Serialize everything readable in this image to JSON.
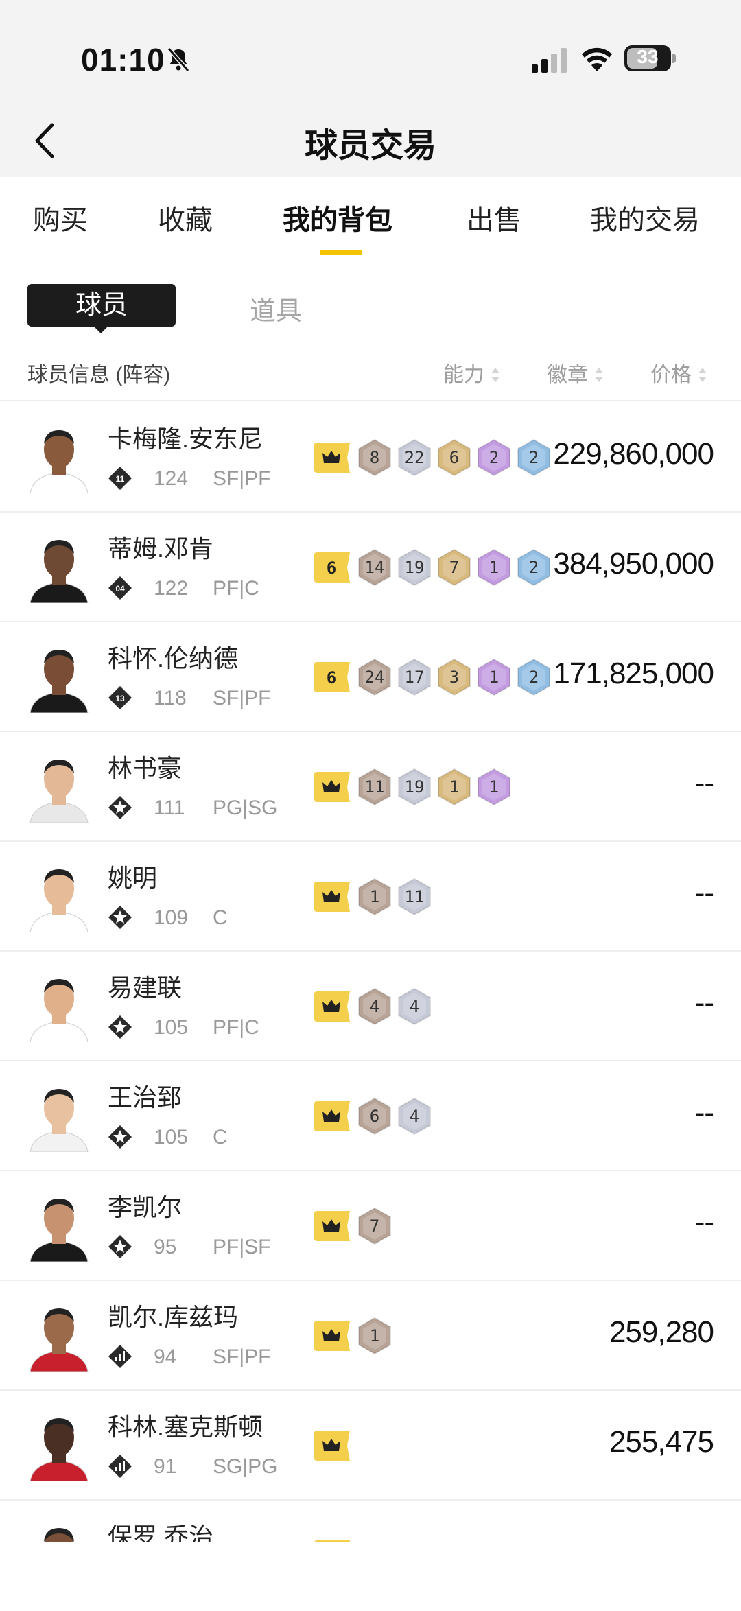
{
  "status_bar": {
    "time": "01:10",
    "battery": "33"
  },
  "nav": {
    "title": "球员交易"
  },
  "tabs": [
    {
      "label": "购买",
      "active": false
    },
    {
      "label": "收藏",
      "active": false
    },
    {
      "label": "我的背包",
      "active": true
    },
    {
      "label": "出售",
      "active": false
    },
    {
      "label": "我的交易",
      "active": false
    }
  ],
  "subtabs": {
    "active": "球员",
    "inactive": "道具"
  },
  "table_header": {
    "info": "球员信息 (阵容)",
    "ability": "能力",
    "badge": "徽章",
    "price": "价格"
  },
  "colors": {
    "accent": "#f5c400",
    "crown": "#f4cf4c",
    "hex_bronze": "#b8a496",
    "hex_silver": "#c6cad7",
    "hex_gold": "#d8b97e",
    "hex_purple": "#c39be0",
    "hex_blue": "#92bde3"
  },
  "players": [
    {
      "name": "卡梅隆.安东尼",
      "level_icon": "tier-11-diamond-icon",
      "level": "11",
      "rating": "124",
      "position": "SF|PF",
      "first_badge": "crown",
      "badges": [
        "8",
        "22",
        "6",
        "2",
        "2"
      ],
      "price": "229,860,000"
    },
    {
      "name": "蒂姆.邓肯",
      "level_icon": "tier-04-diamond-icon",
      "level": "04",
      "rating": "122",
      "position": "PF|C",
      "first_badge": "6",
      "badges": [
        "14",
        "19",
        "7",
        "1",
        "2"
      ],
      "price": "384,950,000"
    },
    {
      "name": "科怀.伦纳德",
      "level_icon": "tier-13-diamond-icon",
      "level": "13",
      "rating": "118",
      "position": "SF|PF",
      "first_badge": "6",
      "badges": [
        "24",
        "17",
        "3",
        "1",
        "2"
      ],
      "price": "171,825,000"
    },
    {
      "name": "林书豪",
      "level_icon": "star-diamond-icon",
      "level": "",
      "rating": "111",
      "position": "PG|SG",
      "first_badge": "crown",
      "badges": [
        "11",
        "19",
        "1",
        "1"
      ],
      "price": "--"
    },
    {
      "name": "姚明",
      "level_icon": "star-diamond-icon",
      "level": "",
      "rating": "109",
      "position": "C",
      "first_badge": "crown",
      "badges": [
        "1",
        "11"
      ],
      "price": "--"
    },
    {
      "name": "易建联",
      "level_icon": "star-diamond-icon",
      "level": "",
      "rating": "105",
      "position": "PF|C",
      "first_badge": "crown",
      "badges": [
        "4",
        "4"
      ],
      "price": "--"
    },
    {
      "name": "王治郅",
      "level_icon": "star-diamond-icon",
      "level": "",
      "rating": "105",
      "position": "C",
      "first_badge": "crown",
      "badges": [
        "6",
        "4"
      ],
      "price": "--"
    },
    {
      "name": "李凯尔",
      "level_icon": "star-diamond-icon",
      "level": "",
      "rating": "95",
      "position": "PF|SF",
      "first_badge": "crown",
      "badges": [
        "7"
      ],
      "price": "--"
    },
    {
      "name": "凯尔.库兹玛",
      "level_icon": "bars-diamond-icon",
      "level": "",
      "rating": "94",
      "position": "SF|PF",
      "first_badge": "crown",
      "badges": [
        "1"
      ],
      "price": "259,280"
    },
    {
      "name": "科林.塞克斯顿",
      "level_icon": "bars-diamond-icon",
      "level": "",
      "rating": "91",
      "position": "SG|PG",
      "first_badge": "crown",
      "badges": [],
      "price": "255,475"
    },
    {
      "name": "保罗.乔治",
      "level_icon": "bars-diamond-icon",
      "level": "",
      "rating": "",
      "position": "",
      "first_badge": "crown",
      "badges": [],
      "price": ""
    }
  ]
}
